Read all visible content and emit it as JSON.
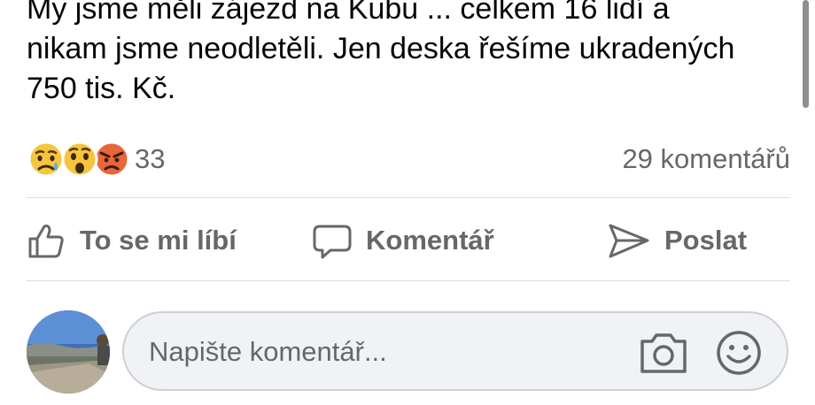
{
  "post": {
    "text_lines": [
      "My jsme měli zájezd na Kubu ... celkem  16 lidí a",
      "nikam jsme neodletěli. Jen deska řešíme ukradených",
      "750 tis. Kč."
    ]
  },
  "reactions": {
    "icons": [
      "sad-emoji-icon",
      "wow-emoji-icon",
      "angry-emoji-icon"
    ],
    "count": "33",
    "comments_count": "29 komentářů"
  },
  "actions": {
    "like_label": "To se mi líbí",
    "comment_label": "Komentář",
    "share_label": "Poslat"
  },
  "comment_input": {
    "placeholder": "Napište komentář..."
  },
  "colors": {
    "text": "#050505",
    "secondary_text": "#65676b",
    "divider": "#dadde1",
    "input_background": "#f0f2f5"
  }
}
